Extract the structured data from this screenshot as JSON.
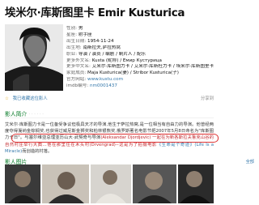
{
  "title": "埃米尔·库斯图里卡 Emir Kusturica",
  "info": [
    {
      "key": "性别:",
      "value": "男"
    },
    {
      "key": "星座:",
      "value": "射手座"
    },
    {
      "key": "出生日期:",
      "value": "1954-11-24"
    },
    {
      "key": "出生地:",
      "value": "南斯拉夫,萨拉热窝"
    },
    {
      "key": "职业:",
      "value": "导演 / 演员 / 编剧 / 制片人 / 配乐"
    },
    {
      "key": "更多外文名:",
      "value": "Kusta (昵称) / Емир Кустурица"
    },
    {
      "key": "更多中文名:",
      "value": "艾米尔·库斯图力卡 / 艾米尔·库斯杜力卡 / 埃米尔·库斯图里卡"
    },
    {
      "key": "家庭成员:",
      "value": "Maja Kusturica(妻) / Stribor Kusturica(子)"
    },
    {
      "key": "官方网站:",
      "value": "www.kustu.com"
    },
    {
      "key": "imdb编号:",
      "value": "nm0001437"
    }
  ],
  "rowbar": {
    "star": "☆",
    "fav": "我已收藏这位影人",
    "share": "分享到"
  },
  "bio_heading": "影人简介",
  "bio_dots": "·  ·  ·  ·  ·  ·",
  "bio_text": "艾米尔·库斯图力卡是一位备受争议但极具天才的导演,他生于萨拉热窝,是一位相当有自由力的导演。他曾经两度夺得戛纳金棕榈奖,也获得过威尼斯金狮奖和柏林银熊奖,俄罗斯著名电影节把2007年5月8日命名为\"库斯图力卡日\"。与塞尔维亚总理亚历山大·武契奇与导演",
  "bio_hl": "(Aleksandar Djordjevic) 一起在为新各斯拉夫鲁克山谷的自然村庄举行大典...他在那里住在木头村",
  "bio_link1": "(Drvengrad)",
  "bio_tail": "--这是为了拍摄电影",
  "bio_link2": "《生命是个奇迹》(Life Is a Miracle)",
  "bio_end": "而创造的村落。",
  "photos_heading": "影人图片",
  "photos_all": "全部",
  "accent": "#007722",
  "link_color": "#3377aa"
}
